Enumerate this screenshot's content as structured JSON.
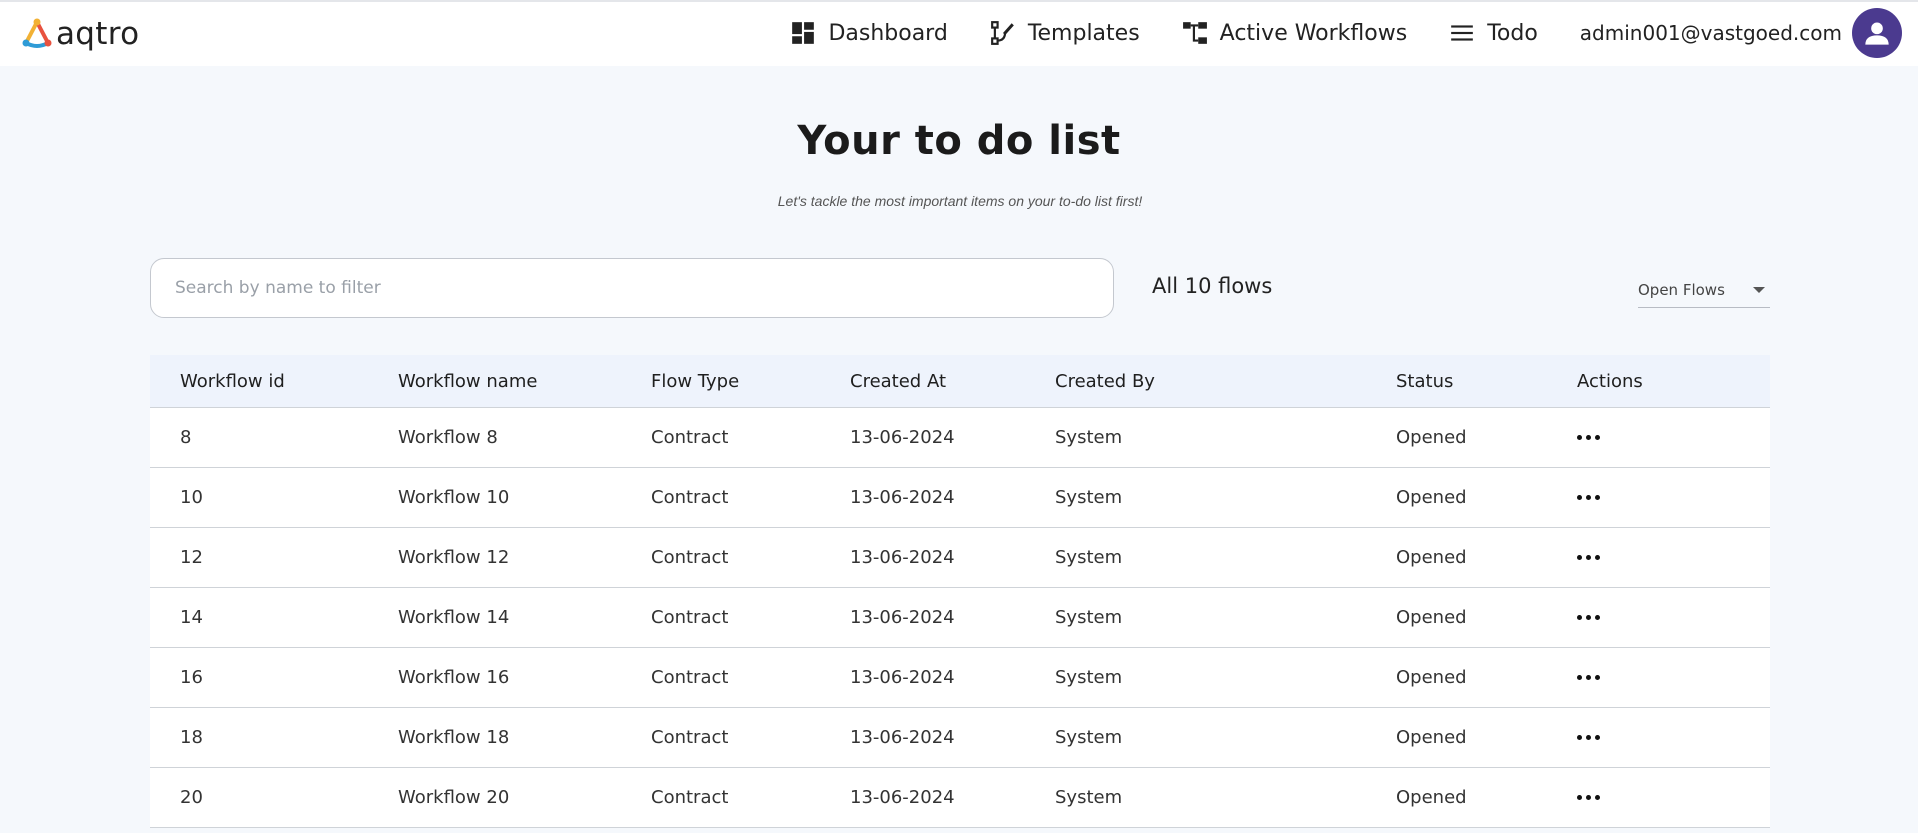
{
  "app": {
    "name": "aqtro"
  },
  "nav": {
    "items": [
      {
        "label": "Dashboard",
        "icon": "dashboard-icon"
      },
      {
        "label": "Templates",
        "icon": "templates-icon"
      },
      {
        "label": "Active Workflows",
        "icon": "workflow-icon"
      },
      {
        "label": "Todo",
        "icon": "menu-icon"
      }
    ],
    "user_email": "admin001@vastgoed.com"
  },
  "page": {
    "title": "Your to do list",
    "subtitle": "Let's tackle the most important items on your to-do list first!"
  },
  "filters": {
    "search_placeholder": "Search by name to filter",
    "search_value": "",
    "count_label": "All 10 flows",
    "select_value": "Open Flows"
  },
  "table": {
    "columns": [
      "Workflow id",
      "Workflow name",
      "Flow Type",
      "Created At",
      "Created By",
      "Status",
      "Actions"
    ],
    "rows": [
      {
        "id": "8",
        "name": "Workflow 8",
        "type": "Contract",
        "created_at": "13-06-2024",
        "created_by": "System",
        "status": "Opened"
      },
      {
        "id": "10",
        "name": "Workflow 10",
        "type": "Contract",
        "created_at": "13-06-2024",
        "created_by": "System",
        "status": "Opened"
      },
      {
        "id": "12",
        "name": "Workflow 12",
        "type": "Contract",
        "created_at": "13-06-2024",
        "created_by": "System",
        "status": "Opened"
      },
      {
        "id": "14",
        "name": "Workflow 14",
        "type": "Contract",
        "created_at": "13-06-2024",
        "created_by": "System",
        "status": "Opened"
      },
      {
        "id": "16",
        "name": "Workflow 16",
        "type": "Contract",
        "created_at": "13-06-2024",
        "created_by": "System",
        "status": "Opened"
      },
      {
        "id": "18",
        "name": "Workflow 18",
        "type": "Contract",
        "created_at": "13-06-2024",
        "created_by": "System",
        "status": "Opened"
      },
      {
        "id": "20",
        "name": "Workflow 20",
        "type": "Contract",
        "created_at": "13-06-2024",
        "created_by": "System",
        "status": "Opened"
      }
    ]
  },
  "colors": {
    "avatar": "#4b3a8f",
    "header_row": "#eef3fc",
    "page_bg": "#f5f8fc"
  }
}
